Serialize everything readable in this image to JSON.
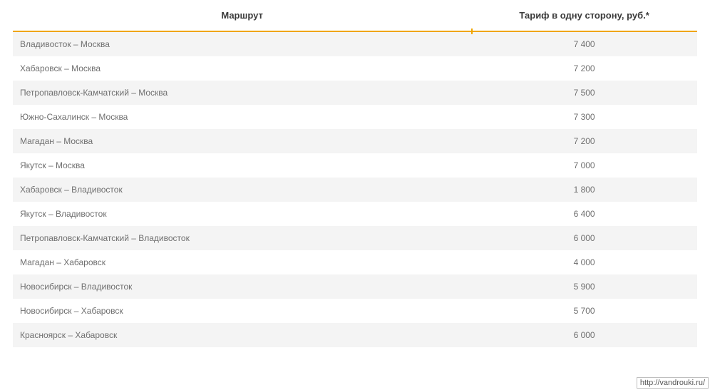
{
  "table": {
    "headers": {
      "route": "Маршрут",
      "price": "Тариф в одну сторону, руб.*"
    },
    "rows": [
      {
        "route": "Владивосток – Москва",
        "price": "7 400"
      },
      {
        "route": "Хабаровск – Москва",
        "price": "7 200"
      },
      {
        "route": "Петропавловск-Камчатский – Москва",
        "price": "7 500"
      },
      {
        "route": "Южно-Сахалинск – Москва",
        "price": "7 300"
      },
      {
        "route": "Магадан – Москва",
        "price": "7 200"
      },
      {
        "route": "Якутск – Москва",
        "price": "7 000"
      },
      {
        "route": "Хабаровск – Владивосток",
        "price": "1 800"
      },
      {
        "route": "Якутск – Владивосток",
        "price": "6 400"
      },
      {
        "route": "Петропавловск-Камчатский – Владивосток",
        "price": "6 000"
      },
      {
        "route": "Магадан – Хабаровск",
        "price": "4 000"
      },
      {
        "route": "Новосибирск – Владивосток",
        "price": "5 900"
      },
      {
        "route": "Новосибирск – Хабаровск",
        "price": "5 700"
      },
      {
        "route": "Красноярск – Хабаровск",
        "price": "6 000"
      }
    ]
  },
  "watermark": "http://vandrouki.ru/"
}
